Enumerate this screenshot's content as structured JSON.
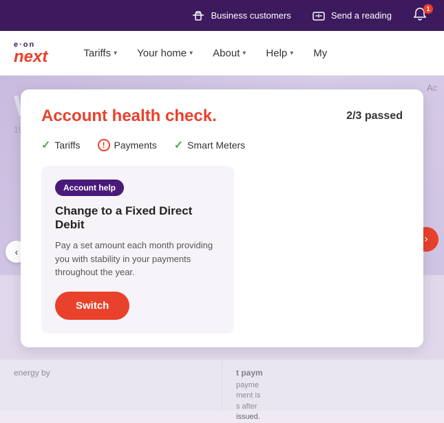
{
  "utility_bar": {
    "business_customers_label": "Business customers",
    "send_reading_label": "Send a reading",
    "notification_count": "1"
  },
  "nav": {
    "logo": {
      "eon": "e·on",
      "next": "next"
    },
    "items": [
      {
        "label": "Tariffs",
        "has_dropdown": true
      },
      {
        "label": "Your home",
        "has_dropdown": true
      },
      {
        "label": "About",
        "has_dropdown": true
      },
      {
        "label": "Help",
        "has_dropdown": true
      },
      {
        "label": "My",
        "has_dropdown": false
      }
    ]
  },
  "modal": {
    "title": "Account health check.",
    "score": "2/3 passed",
    "checks": [
      {
        "label": "Tariffs",
        "status": "pass"
      },
      {
        "label": "Payments",
        "status": "warn"
      },
      {
        "label": "Smart Meters",
        "status": "pass"
      }
    ],
    "inner_card": {
      "badge": "Account help",
      "title": "Change to a Fixed Direct Debit",
      "description": "Pay a set amount each month providing you with stability in your payments throughout the year.",
      "switch_label": "Switch"
    }
  },
  "background": {
    "hero_text": "Wo",
    "address": "192 G",
    "account_label": "Ac",
    "right_payment_title": "t paym",
    "right_payment_text": "payme\nment is\ns after\nissued.",
    "bottom_left_text": "energy by",
    "bottom_right_title": "t paym",
    "bottom_right_text": "payme\npment is\ns after\nissued."
  },
  "icons": {
    "briefcase": "💼",
    "meter": "📟",
    "bell": "🔔",
    "chevron_down": "▾",
    "check": "✓",
    "exclaim": "!"
  }
}
